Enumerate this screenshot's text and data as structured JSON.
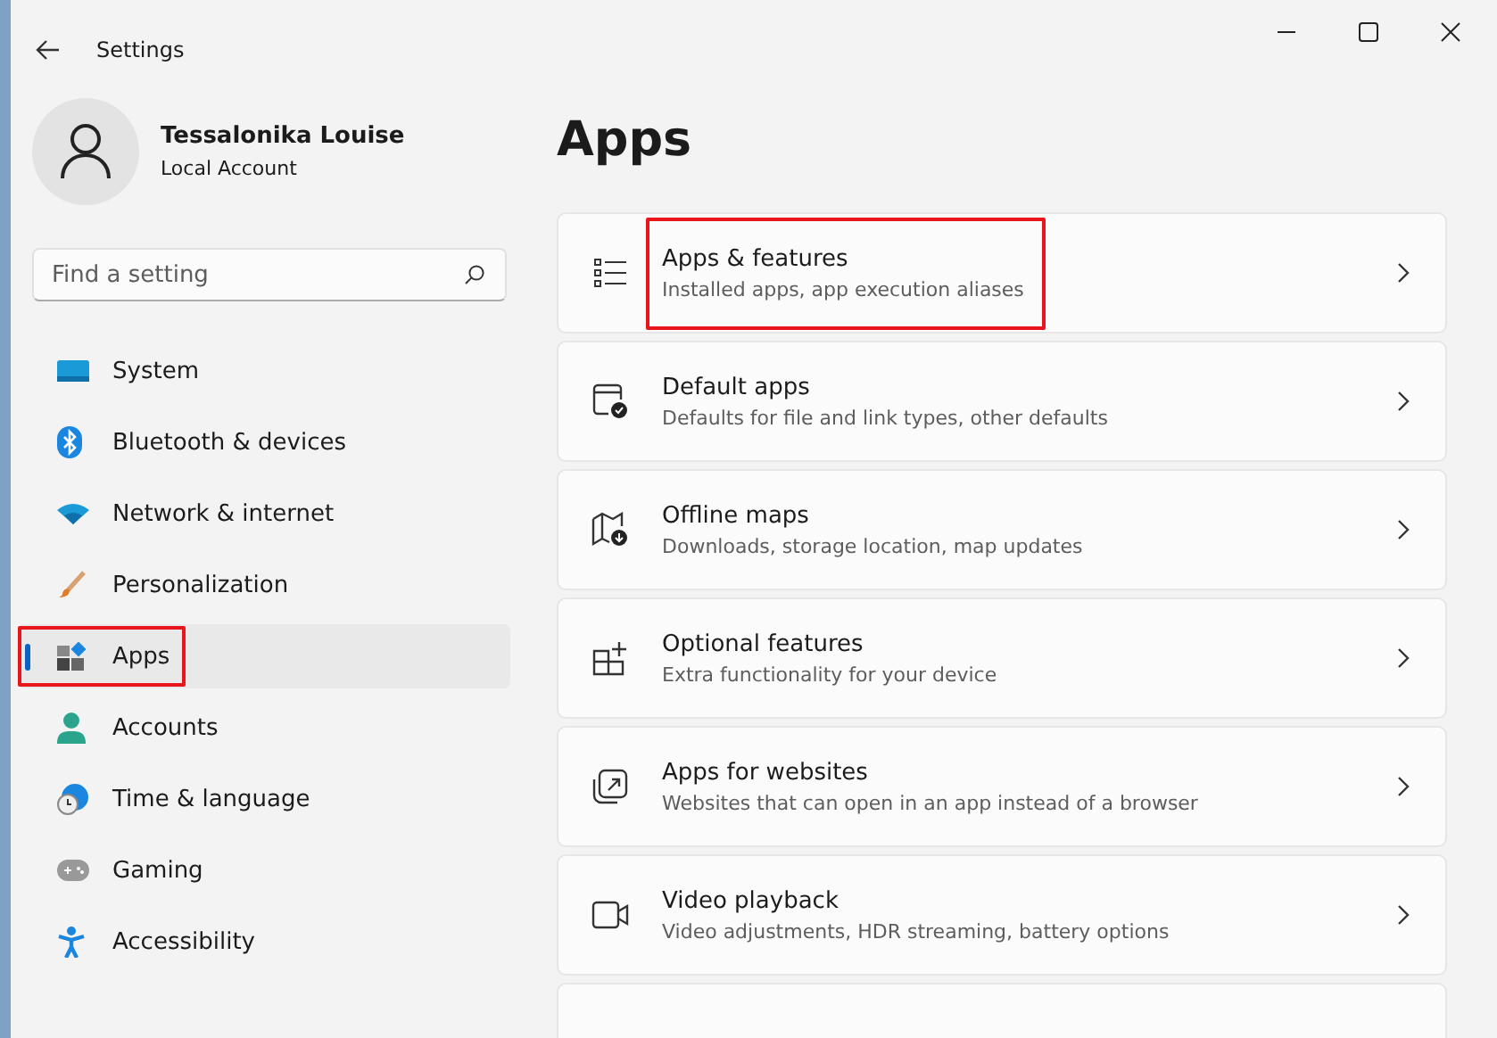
{
  "window": {
    "title": "Settings"
  },
  "profile": {
    "name": "Tessalonika Louise",
    "account": "Local Account"
  },
  "search": {
    "placeholder": "Find a setting"
  },
  "sidebar": {
    "items": [
      {
        "label": "System",
        "kind": "system",
        "selected": false,
        "highlighted": false
      },
      {
        "label": "Bluetooth & devices",
        "kind": "bluetooth",
        "selected": false,
        "highlighted": false
      },
      {
        "label": "Network & internet",
        "kind": "wifi",
        "selected": false,
        "highlighted": false
      },
      {
        "label": "Personalization",
        "kind": "brush",
        "selected": false,
        "highlighted": false
      },
      {
        "label": "Apps",
        "kind": "apps",
        "selected": true,
        "highlighted": true
      },
      {
        "label": "Accounts",
        "kind": "person",
        "selected": false,
        "highlighted": false
      },
      {
        "label": "Time & language",
        "kind": "clock",
        "selected": false,
        "highlighted": false
      },
      {
        "label": "Gaming",
        "kind": "gamepad",
        "selected": false,
        "highlighted": false
      },
      {
        "label": "Accessibility",
        "kind": "accessibility",
        "selected": false,
        "highlighted": false
      }
    ]
  },
  "page": {
    "heading": "Apps",
    "cards": [
      {
        "title": "Apps & features",
        "subtitle": "Installed apps, app execution aliases",
        "kind": "list",
        "highlighted": true
      },
      {
        "title": "Default apps",
        "subtitle": "Defaults for file and link types, other defaults",
        "kind": "window-check",
        "highlighted": false
      },
      {
        "title": "Offline maps",
        "subtitle": "Downloads, storage location, map updates",
        "kind": "map",
        "highlighted": false
      },
      {
        "title": "Optional features",
        "subtitle": "Extra functionality for your device",
        "kind": "grid-plus",
        "highlighted": false
      },
      {
        "title": "Apps for websites",
        "subtitle": "Websites that can open in an app instead of a browser",
        "kind": "external",
        "highlighted": false
      },
      {
        "title": "Video playback",
        "subtitle": "Video adjustments, HDR streaming, battery options",
        "kind": "camera",
        "highlighted": false
      },
      {
        "kind": "cut-off"
      }
    ]
  }
}
